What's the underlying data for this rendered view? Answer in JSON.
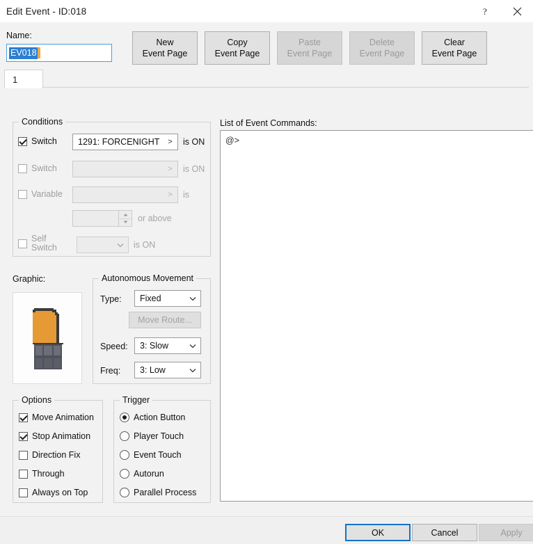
{
  "window": {
    "title": "Edit Event - ID:018",
    "help_icon": "question-mark-icon",
    "close_icon": "close-icon"
  },
  "name": {
    "label": "Name:",
    "value": "EV018"
  },
  "toolbar": {
    "buttons": [
      {
        "line1": "New",
        "line2": "Event Page",
        "enabled": true
      },
      {
        "line1": "Copy",
        "line2": "Event Page",
        "enabled": true
      },
      {
        "line1": "Paste",
        "line2": "Event Page",
        "enabled": false
      },
      {
        "line1": "Delete",
        "line2": "Event Page",
        "enabled": false
      },
      {
        "line1": "Clear",
        "line2": "Event Page",
        "enabled": true
      }
    ]
  },
  "tabs": [
    {
      "label": "1",
      "selected": true
    }
  ],
  "conditions": {
    "legend": "Conditions",
    "switch1": {
      "label": "Switch",
      "checked": true,
      "value": "1291: FORCENIGHT",
      "arrow": ">",
      "suffix": "is ON"
    },
    "switch2": {
      "label": "Switch",
      "checked": false,
      "value": "",
      "arrow": ">",
      "suffix": "is ON"
    },
    "variable": {
      "label": "Variable",
      "checked": false,
      "value": "",
      "arrow": ">",
      "suffix": "is",
      "amount": "",
      "amount_suffix": "or above"
    },
    "self_switch": {
      "label_line1": "Self",
      "label_line2": "Switch",
      "checked": false,
      "value": "",
      "suffix": "is ON"
    }
  },
  "graphic": {
    "label": "Graphic:",
    "sprite_colors": {
      "body": "#e59a36",
      "outline": "#3a3a3a",
      "base_dark": "#4f525a",
      "base_light": "#6c6f77"
    }
  },
  "autonomous_movement": {
    "legend": "Autonomous Movement",
    "type_label": "Type:",
    "type_value": "Fixed",
    "move_route_label": "Move Route...",
    "move_route_enabled": false,
    "speed_label": "Speed:",
    "speed_value": "3: Slow",
    "freq_label": "Freq:",
    "freq_value": "3: Low"
  },
  "options": {
    "legend": "Options",
    "items": [
      {
        "label": "Move Animation",
        "checked": true
      },
      {
        "label": "Stop Animation",
        "checked": true
      },
      {
        "label": "Direction Fix",
        "checked": false
      },
      {
        "label": "Through",
        "checked": false
      },
      {
        "label": "Always on Top",
        "checked": false
      }
    ]
  },
  "trigger": {
    "legend": "Trigger",
    "items": [
      {
        "label": "Action Button",
        "selected": true
      },
      {
        "label": "Player Touch",
        "selected": false
      },
      {
        "label": "Event Touch",
        "selected": false
      },
      {
        "label": "Autorun",
        "selected": false
      },
      {
        "label": "Parallel Process",
        "selected": false
      }
    ]
  },
  "event_commands": {
    "label": "List of Event Commands:",
    "items": [
      "@>"
    ]
  },
  "footer": {
    "ok": "OK",
    "cancel": "Cancel",
    "apply": "Apply",
    "apply_enabled": false
  }
}
